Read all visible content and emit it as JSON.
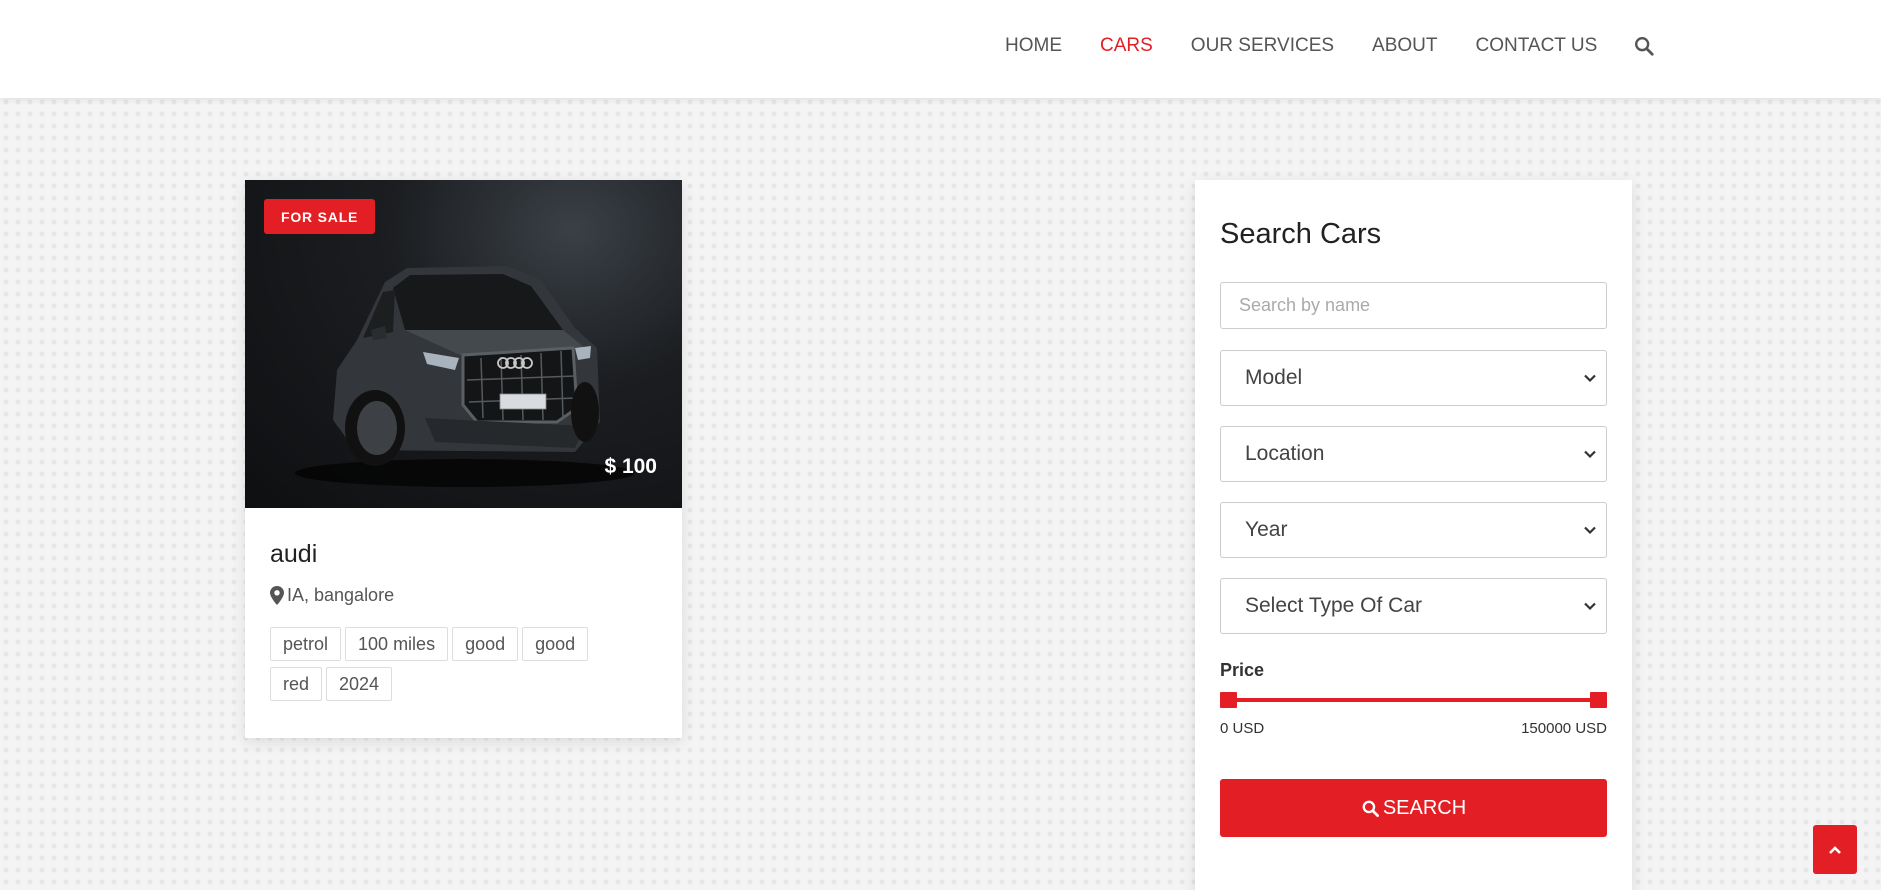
{
  "nav": {
    "items": [
      {
        "label": "HOME",
        "active": false
      },
      {
        "label": "CARS",
        "active": true
      },
      {
        "label": "OUR SERVICES",
        "active": false
      },
      {
        "label": "ABOUT",
        "active": false
      },
      {
        "label": "CONTACT US",
        "active": false
      }
    ],
    "search_icon": "search-icon",
    "active_color": "#e31e24"
  },
  "listing": {
    "badge": "FOR SALE",
    "price": "$ 100",
    "title": "audi",
    "location": "IA, bangalore",
    "tags": [
      "petrol",
      "100 miles",
      "good",
      "good",
      "red",
      "2024"
    ]
  },
  "search_panel": {
    "title": "Search Cars",
    "name_placeholder": "Search by name",
    "name_value": "",
    "model_select": "Model",
    "location_select": "Location",
    "year_select": "Year",
    "type_select": "Select Type Of Car",
    "price_label": "Price",
    "price_min": "0 USD",
    "price_max": "150000 USD",
    "search_button": "SEARCH"
  },
  "colors": {
    "accent": "#e31e24",
    "text": "#333333",
    "background": "#f4f4f4"
  }
}
